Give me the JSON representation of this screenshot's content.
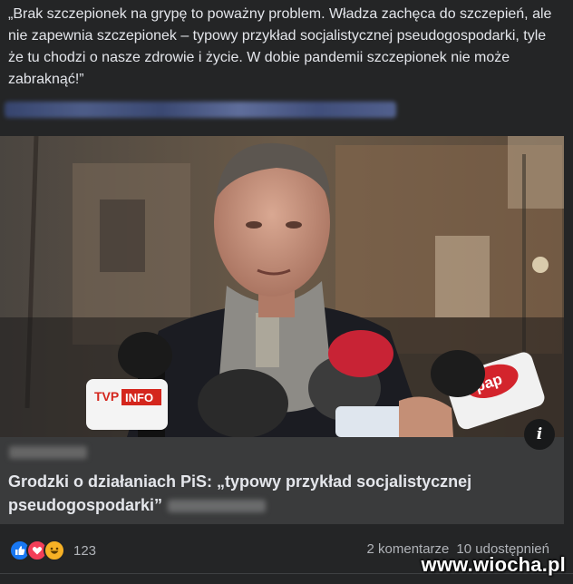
{
  "post": {
    "text": "„Brak szczepionek na grypę to poważny problem. Władza zachęca do szczepień, ale nie zapewnia szczepionek – typowy przykład socjalistycznej pseudogospodarki, tyle że tu chodzi o nasze zdrowie i życie. W dobie pandemii szczepionek nie może zabraknąć!”"
  },
  "link": {
    "title": "Grodzki o działaniach PiS: „typowy przykład socjalistycznej pseudogospodarki”",
    "info_icon": "i",
    "mic_labels": {
      "tvp_logo": "TVP",
      "tvp_info": "INFO",
      "pap": "pap"
    }
  },
  "footer": {
    "reaction_icons": [
      "like-icon",
      "love-icon",
      "haha-icon"
    ],
    "reaction_count": "123",
    "comments": "2 komentarze",
    "shares": "10 udostępnień"
  },
  "watermark": "www.wiocha.pl"
}
